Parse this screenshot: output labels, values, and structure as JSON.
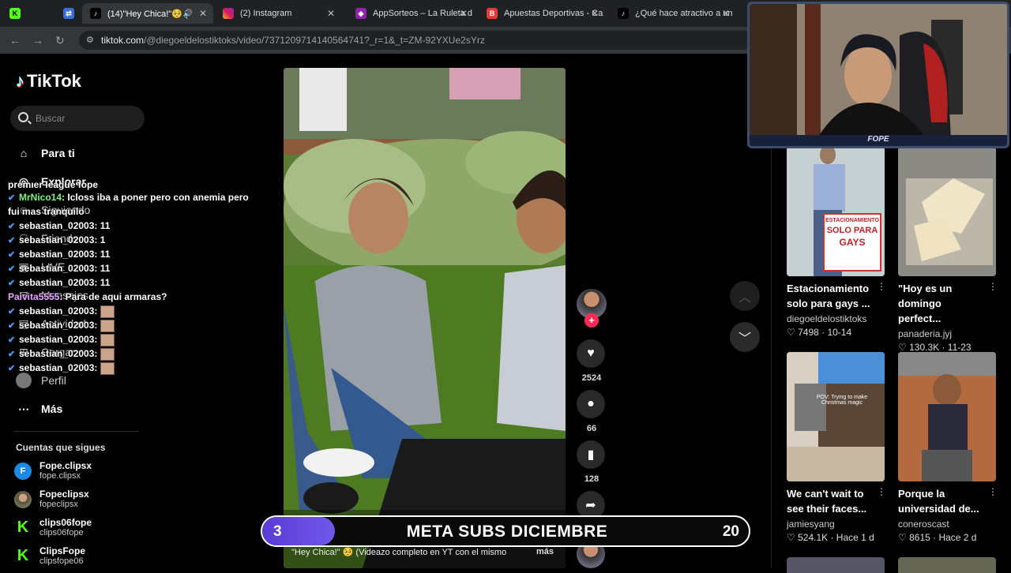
{
  "browser": {
    "tabs": [
      {
        "title": "",
        "icon": "k-icon"
      },
      {
        "title": "",
        "icon": "translate-icon"
      },
      {
        "title": "(14)\"Hey Chica!\"🥺 (",
        "icon": "tiktok-icon",
        "active": true
      },
      {
        "title": "(2) Instagram",
        "icon": "instagram-icon"
      },
      {
        "title": "AppSorteos – La Ruleta d",
        "icon": "appsorteos-icon"
      },
      {
        "title": "Apuestas Deportivas - Ca",
        "icon": "bet-icon"
      },
      {
        "title": "¿Qué hace atractivo a un",
        "icon": "tiktok-icon"
      }
    ],
    "url_host": "tiktok.com",
    "url_path": "/@diegoeldelostiktoks/video/7371209714140564741?_r=1&_t=ZM-92YXUe2sYrz"
  },
  "sidebar": {
    "logo": "TikTok",
    "search_placeholder": "Buscar",
    "nav": [
      {
        "label": "Para ti",
        "icon": "home-icon"
      },
      {
        "label": "Explorar",
        "icon": "compass-icon"
      },
      {
        "label": "Siguiendo",
        "icon": "following-icon"
      },
      {
        "label": "Friends",
        "icon": "friends-icon"
      },
      {
        "label": "LIVE",
        "icon": "live-icon"
      },
      {
        "label": "Mensajes",
        "icon": "messages-icon"
      },
      {
        "label": "Actividad",
        "icon": "activity-icon"
      },
      {
        "label": "Cargar",
        "icon": "upload-icon"
      },
      {
        "label": "Perfil",
        "icon": "profile-icon"
      },
      {
        "label": "Más",
        "icon": "more-icon"
      }
    ],
    "following_title": "Cuentas que sigues",
    "following": [
      {
        "name": "Fope.clipsx",
        "handle": "fope.clipsx",
        "color": "#1e88e5",
        "initial": "F"
      },
      {
        "name": "Fopeclipsx",
        "handle": "fopeclipsx",
        "color": "#8d6e63",
        "initial": ""
      },
      {
        "name": "clips06fope",
        "handle": "clips06fope",
        "color": "#53fc18",
        "initial": "K"
      },
      {
        "name": "ClipsFope",
        "handle": "clipsfope06",
        "color": "#53fc18",
        "initial": "K"
      }
    ]
  },
  "chat": [
    {
      "user": "premier league fope",
      "msg": "",
      "style": "u",
      "partial": true
    },
    {
      "user": "MrNico14",
      "msg": ": Icloss iba a poner pero con anemia pero fui mas tranquilo",
      "style": "g"
    },
    {
      "user": "sebastian_02003",
      "msg": ": 11",
      "style": "u"
    },
    {
      "user": "sebastian_02003",
      "msg": ": 1",
      "style": "u"
    },
    {
      "user": "sebastian_02003",
      "msg": ": 11",
      "style": "u"
    },
    {
      "user": "sebastian_02003",
      "msg": ": 11",
      "style": "u"
    },
    {
      "user": "sebastian_02003",
      "msg": ": 11",
      "style": "u"
    },
    {
      "user": "Paivita5555",
      "msg": ": Para de aqui armaras?",
      "style": "p"
    },
    {
      "user": "sebastian_02003",
      "msg": ":",
      "style": "u",
      "emote": true
    },
    {
      "user": "sebastian_02003",
      "msg": ":",
      "style": "u",
      "emote": true
    },
    {
      "user": "sebastian_02003",
      "msg": ":",
      "style": "u",
      "emote": true
    },
    {
      "user": "sebastian_02003",
      "msg": ":",
      "style": "u",
      "emote": true
    },
    {
      "user": "sebastian_02003",
      "msg": ":",
      "style": "u",
      "emote": true
    }
  ],
  "video": {
    "author_partial": "delostiktoks",
    "caption": "\"Hey Chica!\" 🥺 (Videazo completo en YT con el mismo",
    "more_label": "más"
  },
  "actions": {
    "likes": "2524",
    "comments": "66",
    "saves": "128"
  },
  "recommended": [
    {
      "title": "Estacionamiento solo para gays ...",
      "user": "diegoeldelostiktoks",
      "stats": "♡ 7498 · 10-14",
      "sign_lines": [
        "ESTACIONAMIENTO",
        "SOLO PARA",
        "GAYS"
      ]
    },
    {
      "title": "\"Hoy es un domingo perfect...",
      "user": "panaderia.jyj",
      "stats": "♡ 130.3K · 11-23"
    },
    {
      "title": "We can't wait to see their faces...",
      "user": "jamiesyang",
      "stats": "♡ 524.1K · Hace 1 d",
      "overlay": "POV: Trying to make Christmas magic"
    },
    {
      "title": "Porque la universidad de...",
      "user": "coneroscast",
      "stats": "♡ 8615 · Hace 2 d"
    }
  ],
  "webcam": {
    "label": "FOPE"
  },
  "goal": {
    "current": "3",
    "label": "META SUBS DICIEMBRE",
    "target": "20",
    "progress_fraction": 0.15
  }
}
